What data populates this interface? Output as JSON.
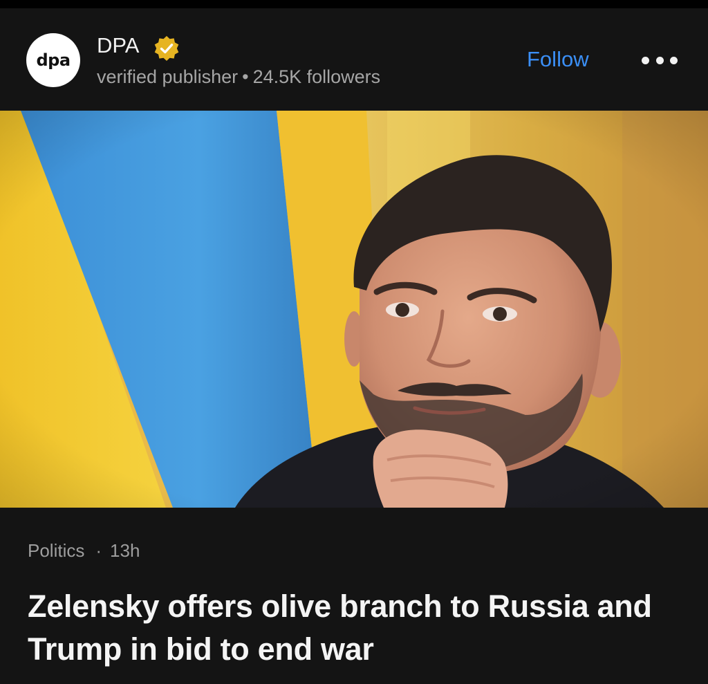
{
  "publisher": {
    "logo_text": "dpa",
    "name": "DPA",
    "verified_icon": "verified-badge-icon",
    "type_label": "verified publisher",
    "separator": "•",
    "followers": "24.5K followers"
  },
  "actions": {
    "follow_label": "Follow",
    "more_icon": "more-options-icon"
  },
  "article": {
    "image_alt": "Zelensky in front of Ukrainian flags",
    "category": "Politics",
    "separator": "·",
    "age": "13h",
    "headline": "Zelensky offers olive branch to Russia and Trump in bid to end war"
  },
  "colors": {
    "background": "#141414",
    "accent": "#3b8ff6",
    "badge": "#e6b422",
    "flag_blue": "#3a8fd3",
    "flag_yellow": "#f3c928"
  }
}
